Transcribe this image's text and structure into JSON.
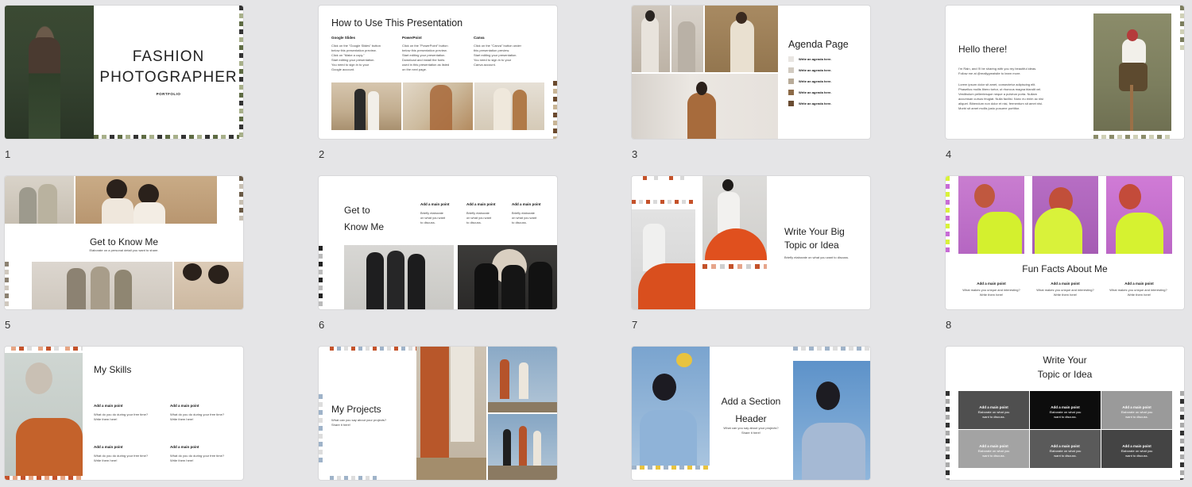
{
  "slides": [
    {
      "number": "1",
      "title_line1": "FASHION",
      "title_line2": "PHOTOGRAPHER",
      "subtitle": "PORTFOLIO"
    },
    {
      "number": "2",
      "title": "How to Use This Presentation",
      "cols": [
        {
          "heading": "Google Slides",
          "lines": [
            "Click on the \"Google Slides\" button",
            "below this presentation preview.",
            "Click on \"Make a copy.\"",
            "Start editing your presentation.",
            "You need to sign in to your",
            "Google account."
          ]
        },
        {
          "heading": "PowerPoint",
          "lines": [
            "Click on the \"PowerPoint\" button",
            "below this presentation preview.",
            "Start editing your presentation.",
            "Download and install the fonts",
            "used in this presentation as listed",
            "on the next page."
          ]
        },
        {
          "heading": "Canva",
          "lines": [
            "Click on the \"Canva\" button under",
            "this presentation preview.",
            "Start editing your presentation.",
            "You need to sign in to your",
            "Canva account."
          ]
        }
      ]
    },
    {
      "number": "3",
      "title": "Agenda Page",
      "item": "Write an agenda here."
    },
    {
      "number": "4",
      "title": "Hello there!",
      "intro": [
        "I'm Rain, and I'll be sharing with you my beautiful ideas.",
        "Follow me at @reallygreatsite to learn more."
      ],
      "body": [
        "Lorem ipsum dolor sit amet, consectetur adipiscing elit.",
        "Phasellus mollis libero tortor, ut rhoncus magna blandit vel.",
        "Vestibulum pellentesque neque a pulvinar porta. Nullam",
        "accumsan cursus feugiat. Nulla facilisi. Nunc eu enim ac nisi",
        "aliquet. Bibendum non dolor et nisi, fermentum sit amet nisi.",
        "Morbi sit amet mollis justo posuere porttitor."
      ]
    },
    {
      "number": "5",
      "title": "Get to Know Me",
      "subtitle": "Elaborate on a personal detail you want to share."
    },
    {
      "number": "6",
      "title_line1": "Get to",
      "title_line2": "Know Me",
      "point": "Add a main point",
      "desc": [
        "Briefly elaborate",
        "on what you want",
        "to discuss."
      ]
    },
    {
      "number": "7",
      "title_line1": "Write Your Big",
      "title_line2": "Topic or Idea",
      "subtitle": "Briefly elaborate on what you want to discuss."
    },
    {
      "number": "8",
      "title": "Fun Facts About Me",
      "point": "Add a main point",
      "desc": [
        "What makes you unique and interesting?",
        "Write them here!"
      ]
    },
    {
      "number": "9",
      "title": "My Skills",
      "point": "Add a main point",
      "desc": [
        "What do you do during your free time?",
        "Write them here!"
      ]
    },
    {
      "number": "10",
      "title": "My Projects",
      "desc": [
        "What can you say about your projects?",
        "Share it here!"
      ]
    },
    {
      "number": "11",
      "title_line1": "Add a Section",
      "title_line2": "Header",
      "desc": [
        "What can you say about your projects?",
        "Share it here!"
      ]
    },
    {
      "number": "12",
      "title_line1": "Write Your",
      "title_line2": "Topic or Idea",
      "point": "Add a main point",
      "desc": [
        "Elaborate on what you",
        "want to discuss."
      ]
    }
  ],
  "colors": {
    "olive": "#5e6b43",
    "rust": "#c4522a",
    "magenta": "#c86bd6",
    "lime": "#d9f23a"
  }
}
